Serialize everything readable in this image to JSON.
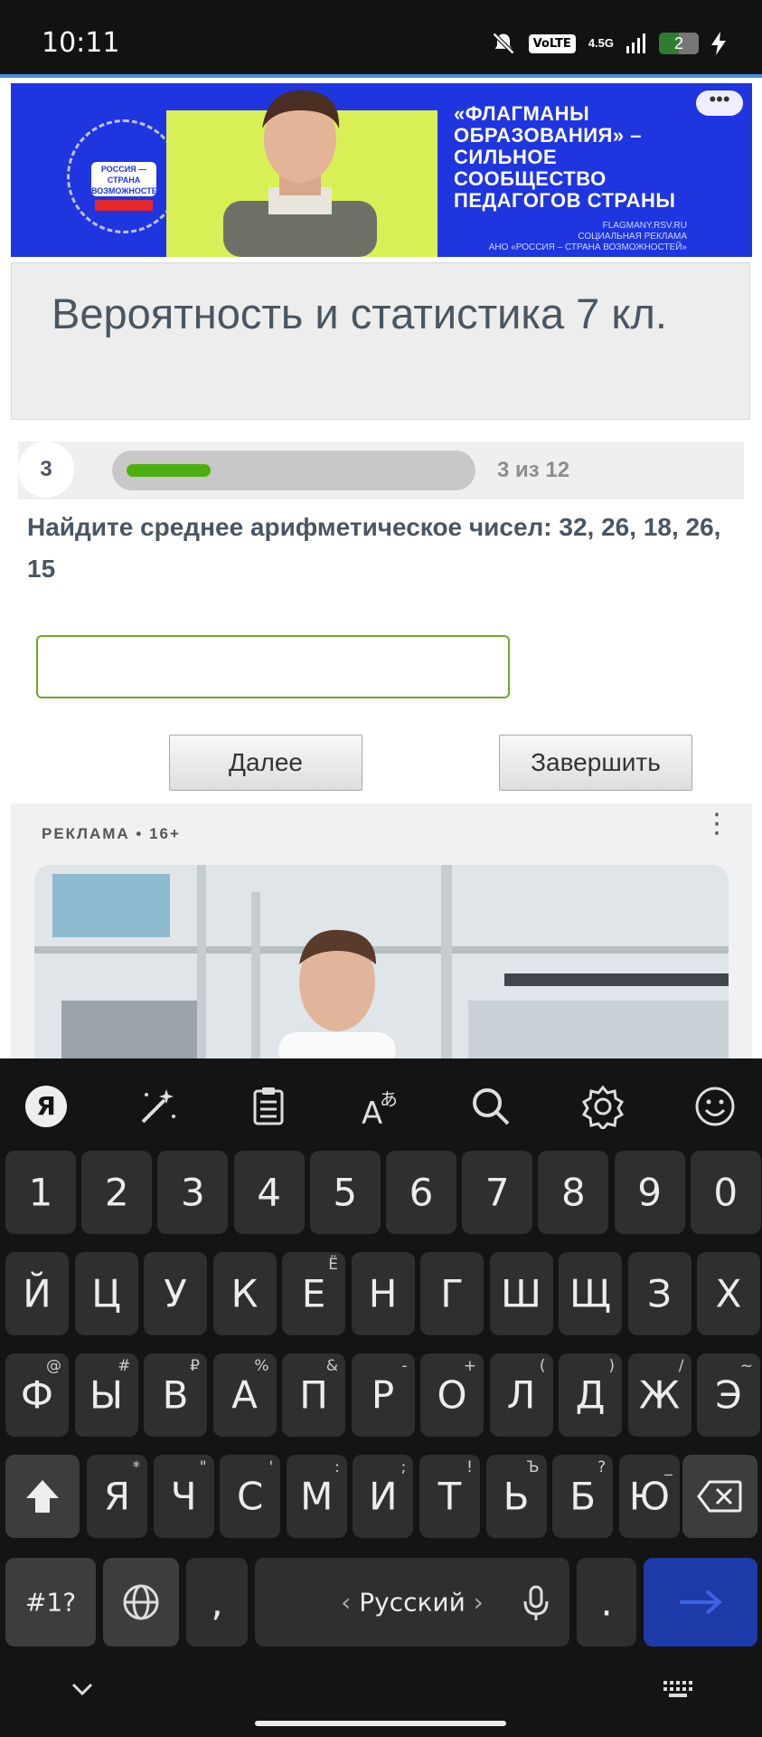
{
  "status_bar": {
    "time": "10:11",
    "volte": "VoLTE",
    "network": "4.5G",
    "battery": "2"
  },
  "banner": {
    "logo_text": "РОССИЯ — СТРАНА ВОЗМОЖНОСТЕЙ",
    "lines": [
      "«ФЛАГМАНЫ",
      "ОБРАЗОВАНИЯ» –",
      "СИЛЬНОЕ",
      "СООБЩЕСТВО",
      "ПЕДАГОГОВ СТРАНЫ"
    ],
    "site": "FLAGMANY.RSV.RU",
    "ad_label": "СОЦИАЛЬНАЯ РЕКЛАМА",
    "org": "АНО «РОССИЯ – СТРАНА ВОЗМОЖНОСТЕЙ»",
    "more": "•••"
  },
  "page": {
    "title": "Вероятность и статистика 7 кл."
  },
  "quiz": {
    "question_number": "3",
    "progress": 0.25,
    "progress_text": "3 из 12",
    "question": "Найдите среднее арифметическое чисел: 32, 26, 18, 26, 15",
    "answer_value": "",
    "next_label": "Далее",
    "finish_label": "Завершить"
  },
  "ad": {
    "label": "РЕКЛАМА • 16+",
    "menu": "⋮"
  },
  "keyboard": {
    "tools": [
      "yandex-icon",
      "magic-wand-icon",
      "clipboard-icon",
      "translate-icon",
      "search-icon",
      "settings-icon",
      "emoji-icon"
    ],
    "row_numbers": [
      "1",
      "2",
      "3",
      "4",
      "5",
      "6",
      "7",
      "8",
      "9",
      "0"
    ],
    "row1": [
      {
        "k": "Й",
        "s": ""
      },
      {
        "k": "Ц",
        "s": ""
      },
      {
        "k": "У",
        "s": ""
      },
      {
        "k": "К",
        "s": ""
      },
      {
        "k": "Е",
        "s": "Ё"
      },
      {
        "k": "Н",
        "s": ""
      },
      {
        "k": "Г",
        "s": ""
      },
      {
        "k": "Ш",
        "s": ""
      },
      {
        "k": "Щ",
        "s": ""
      },
      {
        "k": "З",
        "s": ""
      },
      {
        "k": "Х",
        "s": ""
      }
    ],
    "row2": [
      {
        "k": "Ф",
        "s": "@"
      },
      {
        "k": "Ы",
        "s": "#"
      },
      {
        "k": "В",
        "s": "₽"
      },
      {
        "k": "А",
        "s": "%"
      },
      {
        "k": "П",
        "s": "&"
      },
      {
        "k": "Р",
        "s": "-"
      },
      {
        "k": "О",
        "s": "+"
      },
      {
        "k": "Л",
        "s": "("
      },
      {
        "k": "Д",
        "s": ")"
      },
      {
        "k": "Ж",
        "s": "/"
      },
      {
        "k": "Э",
        "s": "~"
      }
    ],
    "row3": [
      {
        "k": "Я",
        "s": "*"
      },
      {
        "k": "Ч",
        "s": "\""
      },
      {
        "k": "С",
        "s": "'"
      },
      {
        "k": "М",
        "s": ":"
      },
      {
        "k": "И",
        "s": ";"
      },
      {
        "k": "Т",
        "s": "!"
      },
      {
        "k": "Ь",
        "s": "Ъ"
      },
      {
        "k": "Б",
        "s": "?"
      },
      {
        "k": "Ю",
        "s": "_"
      }
    ],
    "symbols_label": "#1?",
    "comma": ",",
    "space_label": "Русский",
    "period": "."
  }
}
